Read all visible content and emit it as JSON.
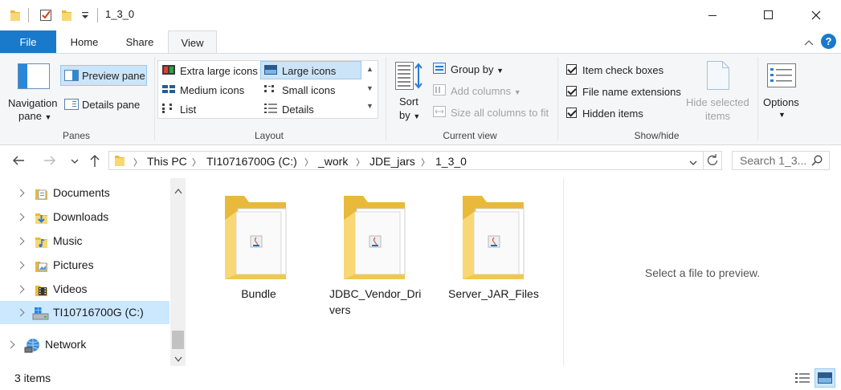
{
  "window": {
    "title": "1_3_0",
    "controls": {
      "minimize": "minimize-icon",
      "maximize": "maximize-icon",
      "close": "close-icon"
    }
  },
  "tabs": {
    "file": "File",
    "home": "Home",
    "share": "Share",
    "view": "View"
  },
  "ribbon": {
    "panes": {
      "navigation_pane": "Navigation",
      "navigation_pane_2": "pane",
      "preview_pane": "Preview pane",
      "details_pane": "Details pane",
      "group_label": "Panes"
    },
    "layout": {
      "extra_large": "Extra large icons",
      "large": "Large icons",
      "medium": "Medium icons",
      "small": "Small icons",
      "list": "List",
      "details": "Details",
      "group_label": "Layout"
    },
    "current_view": {
      "sort": "Sort",
      "sort_2": "by",
      "group_by": "Group by",
      "add_columns": "Add columns",
      "size_all": "Size all columns to fit",
      "group_label": "Current view"
    },
    "show_hide": {
      "item_check_boxes": "Item check boxes",
      "file_name_extensions": "File name extensions",
      "hidden_items": "Hidden items",
      "hide_selected": "Hide selected",
      "hide_selected_2": "items",
      "group_label": "Show/hide"
    },
    "options": "Options"
  },
  "address": {
    "crumbs": [
      "This PC",
      "TI10716700G (C:)",
      "_work",
      "JDE_jars",
      "1_3_0"
    ],
    "search_placeholder": "Search 1_3..."
  },
  "nav_pane": {
    "items": [
      {
        "label": "Documents"
      },
      {
        "label": "Downloads"
      },
      {
        "label": "Music"
      },
      {
        "label": "Pictures"
      },
      {
        "label": "Videos"
      },
      {
        "label": "TI10716700G (C:)"
      },
      {
        "label": "Network"
      }
    ]
  },
  "content": {
    "folders": [
      {
        "name": "Bundle",
        "line2": ""
      },
      {
        "name": "JDBC_Vendor_Dri",
        "line2": "vers"
      },
      {
        "name": "Server_JAR_Files",
        "line2": ""
      }
    ],
    "preview_message": "Select a file to preview."
  },
  "status": {
    "count": "3 items"
  },
  "colors": {
    "accent": "#1979ca",
    "selection": "#cce8ff",
    "folder": "#f8d775"
  }
}
